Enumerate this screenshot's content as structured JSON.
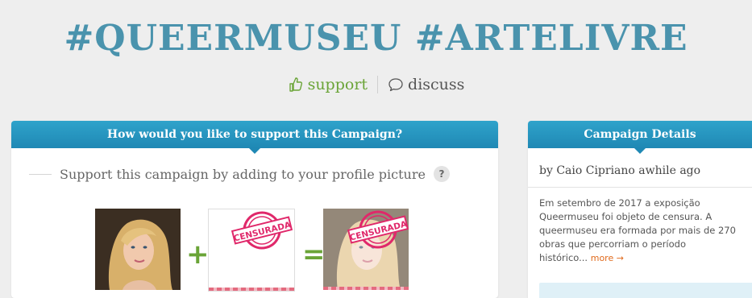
{
  "header": {
    "title": "#QUEERMUSEU #ARTELIVRE",
    "support_label": "support",
    "discuss_label": "discuss"
  },
  "support_panel": {
    "heading": "How would you like to support this Campaign?",
    "instruction": "Support this campaign by adding to your profile picture",
    "help_label": "?",
    "overlay_stamp_text": "CENSURADA",
    "operators": [
      "+",
      "="
    ]
  },
  "details_panel": {
    "heading": "Campaign Details",
    "byline": "by Caio Cipriano awhile ago",
    "description": "Em setembro de 2017 a exposição Queermuseu foi objeto de censura. A queermuseu era formada por mais de 270 obras que percorriam o período histórico...",
    "more_label": "more →"
  },
  "colors": {
    "title": "#4a93ad",
    "accent_green": "#6aa437",
    "header_blue": "#1f88b4",
    "stamp_pink": "#e0286a",
    "more_link": "#e06a1c"
  },
  "icons": [
    "thumbs-up-icon",
    "speech-bubble-icon",
    "help-icon"
  ]
}
